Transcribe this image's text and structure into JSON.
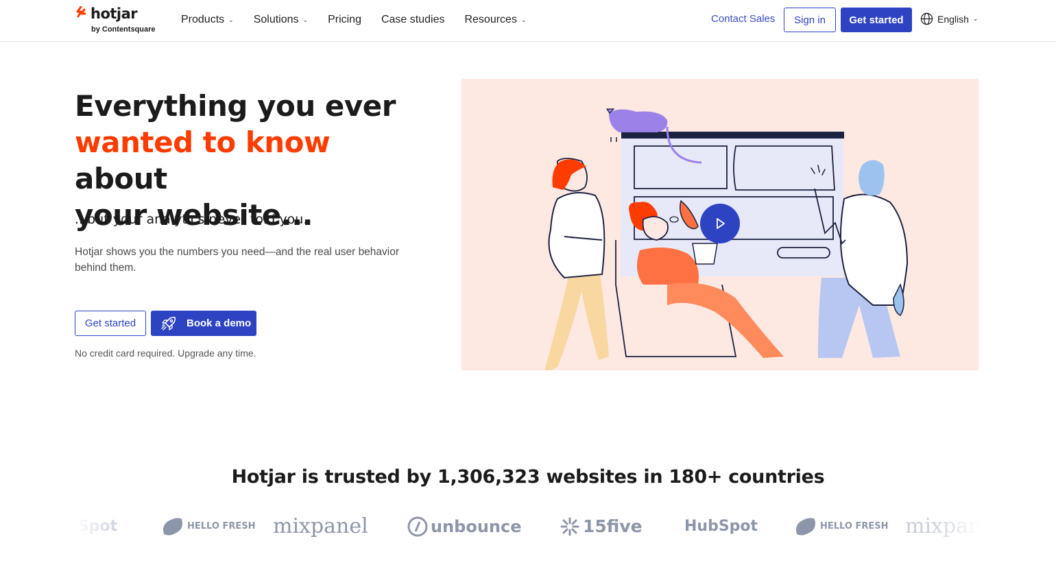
{
  "header": {
    "logo": {
      "word": "hotjar",
      "sub": "by Contentsquare"
    },
    "nav": [
      {
        "label": "Products",
        "has_menu": true
      },
      {
        "label": "Solutions",
        "has_menu": true
      },
      {
        "label": "Pricing",
        "has_menu": false
      },
      {
        "label": "Case studies",
        "has_menu": false
      },
      {
        "label": "Resources",
        "has_menu": true
      }
    ],
    "contact_sales": "Contact Sales",
    "sign_in": "Sign in",
    "get_started": "Get started",
    "language": "English"
  },
  "hero": {
    "title_line1": "Everything you ever",
    "title_accent": "wanted to know",
    "title_after_accent": " about",
    "title_line3": "your website...",
    "subtitle": "...but your analytics never told you.",
    "description": "Hotjar shows you the numbers you need—and the real user behavior behind them.",
    "cta_primary": "Get started",
    "cta_demo": "Book a demo",
    "note": "No credit card required. Upgrade any time."
  },
  "trusted": {
    "heading": "Hotjar is trusted by 1,306,323 websites in 180+ countries",
    "logos": [
      "HubSpot",
      "HELLO FRESH",
      "mixpanel",
      "unbounce",
      "15five",
      "HubSpot",
      "HELLO FRESH",
      "mixpanel"
    ]
  },
  "colors": {
    "accent": "#ff3c00",
    "brand_blue": "#2d43c2",
    "illustration_bg": "#fde8e2",
    "logo_gray": "#8d96a8"
  }
}
